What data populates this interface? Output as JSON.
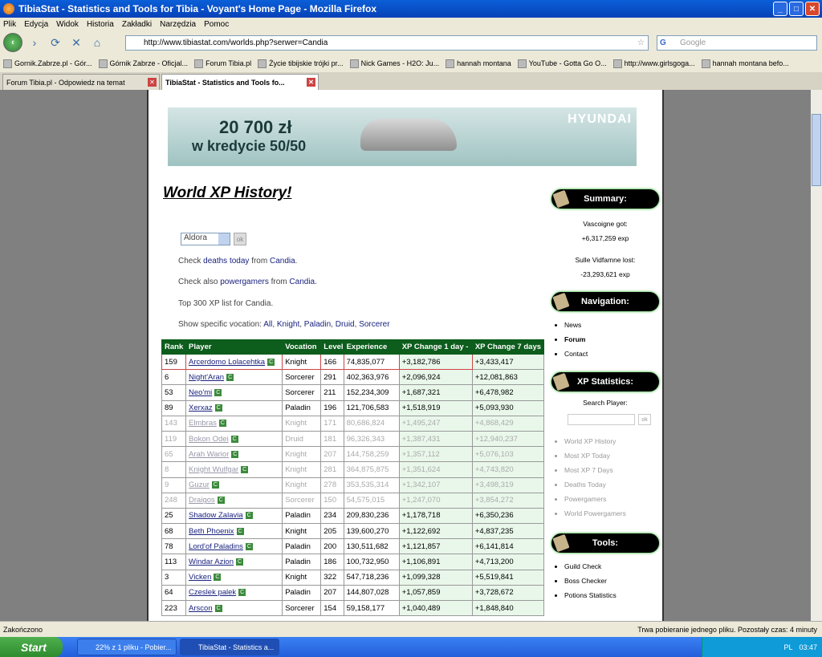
{
  "window": {
    "title": "TibiaStat - Statistics and Tools for Tibia - Voyant's Home Page - Mozilla Firefox"
  },
  "menu": [
    "Plik",
    "Edycja",
    "Widok",
    "Historia",
    "Zakładki",
    "Narzędzia",
    "Pomoc"
  ],
  "address": {
    "url": "http://www.tibiastat.com/worlds.php?serwer=Candia",
    "search_placeholder": "Google"
  },
  "bookmarks": [
    "Gornik.Zabrze.pl - Gór...",
    "Górnik Zabrze - Oficjal...",
    "Forum Tibia.pl",
    "Życie tibijskie trójki pr...",
    "Nick Games - H2O: Ju...",
    "hannah montana",
    "YouTube - Gotta Go O...",
    "http://www.girlsgoga...",
    "hannah montana befo..."
  ],
  "tabs": [
    {
      "label": "Forum Tibia.pl - Odpowiedz na temat"
    },
    {
      "label": "TibiaStat - Statistics and Tools fo..."
    }
  ],
  "ad": {
    "line1": "20 700 zł",
    "line2": "w kredycie 50/50",
    "brand": "HYUNDAI"
  },
  "page": {
    "heading": "World XP History!",
    "world_select": "Aldora",
    "ok": "ok",
    "line1_pre": "Check",
    "line1_link": "deaths today",
    "line1_mid": "from",
    "line1_link2": "Candia",
    "line2_pre": "Check also",
    "line2_link": "powergamers",
    "line2_mid": "from",
    "line2_link2": "Candia",
    "line3": "Top 300 XP list for Candia.",
    "line4_pre": "Show specific vocation:",
    "vocations": [
      "All",
      "Knight",
      "Paladin",
      "Druid",
      "Sorcerer"
    ]
  },
  "table": {
    "headers": [
      "Rank",
      "Player",
      "Vocation",
      "Level",
      "Experience",
      "XP Change 1 day -",
      "XP Change 7 days"
    ],
    "rows": [
      {
        "rank": "159",
        "player": "Arcerdomo Lolacehtka",
        "voc": "Knight",
        "level": "166",
        "exp": "74,835,077",
        "d1": "+3,182,786",
        "d7": "+3,433,417",
        "faded": false
      },
      {
        "rank": "6",
        "player": "Night'Aran",
        "voc": "Sorcerer",
        "level": "291",
        "exp": "402,363,976",
        "d1": "+2,096,924",
        "d7": "+12,081,863",
        "faded": false
      },
      {
        "rank": "53",
        "player": "Neo'mi",
        "voc": "Sorcerer",
        "level": "211",
        "exp": "152,234,309",
        "d1": "+1,687,321",
        "d7": "+6,478,982",
        "faded": false
      },
      {
        "rank": "89",
        "player": "Xerxaz",
        "voc": "Paladin",
        "level": "196",
        "exp": "121,706,583",
        "d1": "+1,518,919",
        "d7": "+5,093,930",
        "faded": false
      },
      {
        "rank": "143",
        "player": "Elmbras",
        "voc": "Knight",
        "level": "171",
        "exp": "80,686,824",
        "d1": "+1,495,247",
        "d7": "+4,868,429",
        "faded": true
      },
      {
        "rank": "119",
        "player": "Bokon Odei",
        "voc": "Druid",
        "level": "181",
        "exp": "96,326,343",
        "d1": "+1,387,431",
        "d7": "+12,940,237",
        "faded": true
      },
      {
        "rank": "65",
        "player": "Arah Warior",
        "voc": "Knight",
        "level": "207",
        "exp": "144,758,259",
        "d1": "+1,357,112",
        "d7": "+5,076,103",
        "faded": true
      },
      {
        "rank": "8",
        "player": "Knight Wulfgar",
        "voc": "Knight",
        "level": "281",
        "exp": "364,875,875",
        "d1": "+1,351,624",
        "d7": "+4,743,820",
        "faded": true
      },
      {
        "rank": "9",
        "player": "Guzur",
        "voc": "Knight",
        "level": "278",
        "exp": "353,535,314",
        "d1": "+1,342,107",
        "d7": "+3,498,319",
        "faded": true
      },
      {
        "rank": "248",
        "player": "Draigos",
        "voc": "Sorcerer",
        "level": "150",
        "exp": "54,575,015",
        "d1": "+1,247,070",
        "d7": "+3,854,272",
        "faded": true
      },
      {
        "rank": "25",
        "player": "Shadow Zalavia",
        "voc": "Paladin",
        "level": "234",
        "exp": "209,830,236",
        "d1": "+1,178,718",
        "d7": "+6,350,236",
        "faded": false
      },
      {
        "rank": "68",
        "player": "Beth Phoenix",
        "voc": "Knight",
        "level": "205",
        "exp": "139,600,270",
        "d1": "+1,122,692",
        "d7": "+4,837,235",
        "faded": false
      },
      {
        "rank": "78",
        "player": "Lord'of Paladins",
        "voc": "Paladin",
        "level": "200",
        "exp": "130,511,682",
        "d1": "+1,121,857",
        "d7": "+6,141,814",
        "faded": false
      },
      {
        "rank": "113",
        "player": "Windar Azion",
        "voc": "Paladin",
        "level": "186",
        "exp": "100,732,950",
        "d1": "+1,106,891",
        "d7": "+4,713,200",
        "faded": false
      },
      {
        "rank": "3",
        "player": "Vicken",
        "voc": "Knight",
        "level": "322",
        "exp": "547,718,236",
        "d1": "+1,099,328",
        "d7": "+5,519,841",
        "faded": false
      },
      {
        "rank": "64",
        "player": "Czeslek palek",
        "voc": "Paladin",
        "level": "207",
        "exp": "144,807,028",
        "d1": "+1,057,859",
        "d7": "+3,728,672",
        "faded": false
      },
      {
        "rank": "223",
        "player": "Arscon",
        "voc": "Sorcerer",
        "level": "154",
        "exp": "59,158,177",
        "d1": "+1,040,489",
        "d7": "+1,848,840",
        "faded": false
      }
    ]
  },
  "sidebar": {
    "summary_title": "Summary:",
    "summary_1": "Vascoigne got:",
    "summary_2": "+6,317,259 exp",
    "summary_3": "Sulle Vidfamne lost:",
    "summary_4": "-23,293,621 exp",
    "nav_title": "Navigation:",
    "nav_items": [
      "News",
      "Forum",
      "Contact"
    ],
    "xp_title": "XP Statistics:",
    "search_label": "Search Player:",
    "search_ok": "ok",
    "xp_items": [
      "World XP History",
      "Most XP Today",
      "Most XP 7 Days",
      "Deaths Today",
      "Powergamers",
      "World Powergamers"
    ],
    "tools_title": "Tools:",
    "tools_items": [
      "Guild Check",
      "Boss Checker",
      "Potions Statistics"
    ]
  },
  "status": {
    "left": "Zakończono",
    "right": "Trwa pobieranie jednego pliku. Pozostały czas: 4 minuty"
  },
  "taskbar": {
    "start": "Start",
    "task1": "22% z 1 pliku - Pobier...",
    "task2": "TibiaStat - Statistics a...",
    "lang": "PL",
    "clock": "03:47"
  }
}
